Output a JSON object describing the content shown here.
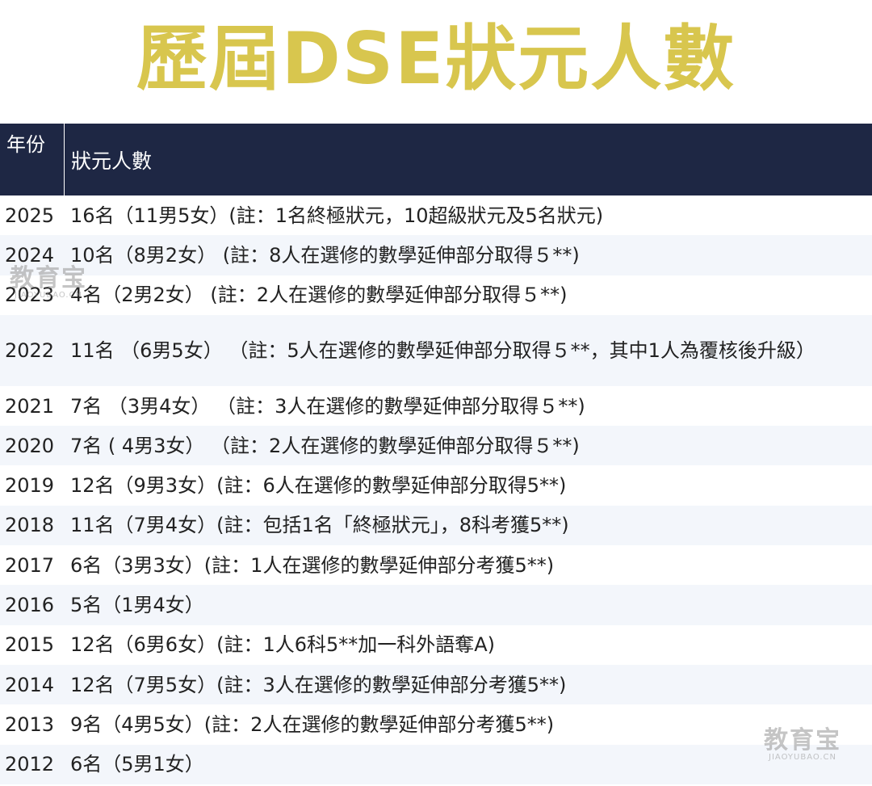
{
  "title": "歷屆DSE狀元人數",
  "colors": {
    "title": "#d8c64e",
    "header_bg": "#1e2744",
    "row_alt_bg": "#f3f6fb",
    "row_bg": "#ffffff"
  },
  "table": {
    "header": {
      "year": "年份",
      "count": "狀元人數"
    },
    "rows": [
      {
        "year": "2025",
        "count": "16名（11男5女）(註：1名終極狀元，10超級狀元及5名狀元)"
      },
      {
        "year": "2024",
        "count": "10名（8男2女） (註：8人在選修的數學延伸部分取得５**)"
      },
      {
        "year": "2023",
        "count": "4名（2男2女） (註：2人在選修的數學延伸部分取得５**)"
      },
      {
        "year": "2022",
        "count": "11名 （6男5女） （註：5人在選修的數學延伸部分取得５**，其中1人為覆核後升級）"
      },
      {
        "year": "2021",
        "count": "7名 （3男4女） （註：3人在選修的數學延伸部分取得５**)"
      },
      {
        "year": "2020",
        "count": "7名 ( 4男3女） （註：2人在選修的數學延伸部分取得５**)"
      },
      {
        "year": "2019",
        "count": "12名（9男3女）(註：6人在選修的數學延伸部分取得5**)"
      },
      {
        "year": "2018",
        "count": "11名（7男4女）(註：包括1名「終極狀元」，8科考獲5**)"
      },
      {
        "year": "2017",
        "count": "6名（3男3女）(註：1人在選修的數學延伸部分考獲5**)"
      },
      {
        "year": "2016",
        "count": "5名（1男4女）"
      },
      {
        "year": "2015",
        "count": "12名（6男6女）(註：1人6科5**加一科外語奪A)"
      },
      {
        "year": "2014",
        "count": "12名（7男5女）(註：3人在選修的數學延伸部分考獲5**)"
      },
      {
        "year": "2013",
        "count": "9名（4男5女）(註：2人在選修的數學延伸部分考獲5**)"
      },
      {
        "year": "2012",
        "count": "6名（5男1女）"
      }
    ]
  },
  "watermarks": [
    {
      "name": "教育宝",
      "domain": "JIAOYUBAO.CN"
    },
    {
      "name": "教育宝",
      "domain": "JIAOYUBAO.CN"
    }
  ]
}
